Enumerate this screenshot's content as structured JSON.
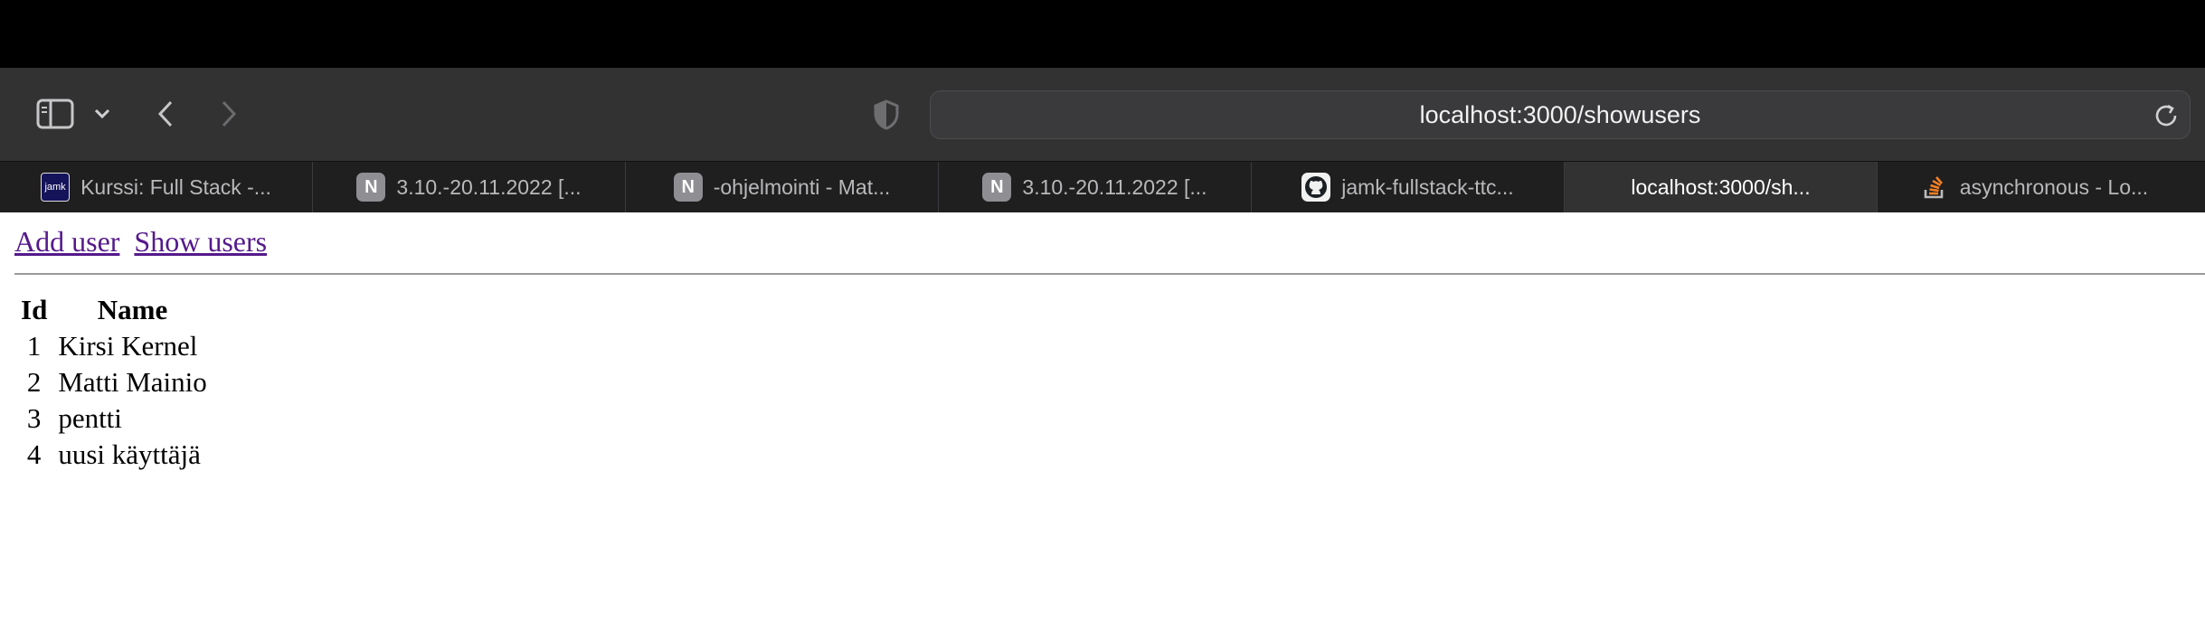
{
  "browser": {
    "url": "localhost:3000/showusers",
    "tabs": [
      {
        "label": "Kurssi: Full Stack -...",
        "favicon": "jamk-icon",
        "favicon_text": "jamk",
        "active": false
      },
      {
        "label": "3.10.-20.11.2022 [...",
        "favicon": "notion-icon",
        "favicon_text": "N",
        "active": false
      },
      {
        "label": "-ohjelmointi - Mat...",
        "favicon": "notion-icon",
        "favicon_text": "N",
        "active": false
      },
      {
        "label": "3.10.-20.11.2022 [...",
        "favicon": "notion-icon",
        "favicon_text": "N",
        "active": false
      },
      {
        "label": "jamk-fullstack-ttc...",
        "favicon": "github-icon",
        "favicon_text": "",
        "active": false
      },
      {
        "label": "localhost:3000/sh...",
        "favicon": "",
        "favicon_text": "",
        "active": true
      },
      {
        "label": "asynchronous - Lo...",
        "favicon": "stackoverflow-icon",
        "favicon_text": "",
        "active": false
      }
    ]
  },
  "page": {
    "nav": {
      "add_user": "Add user",
      "show_users": "Show users"
    },
    "table": {
      "headers": [
        "Id",
        "Name"
      ],
      "rows": [
        [
          "1",
          "Kirsi Kernel"
        ],
        [
          "2",
          "Matti Mainio"
        ],
        [
          "3",
          "pentti"
        ],
        [
          "4",
          "uusi käyttäjä"
        ]
      ]
    }
  },
  "colors": {
    "toolbar": "#323233",
    "tabbar": "#1f1f20",
    "link_visited": "#551a8b"
  }
}
